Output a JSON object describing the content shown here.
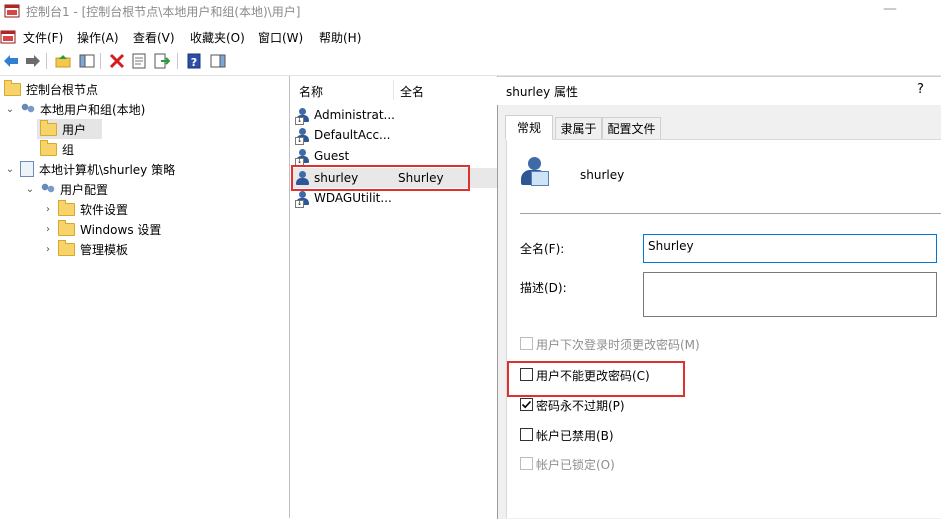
{
  "window": {
    "title": "控制台1 - [控制台根节点\\本地用户和组(本地)\\用户]",
    "minimize_glyph": "—"
  },
  "menu": {
    "items": [
      "文件(F)",
      "操作(A)",
      "查看(V)",
      "收藏夹(O)",
      "窗口(W)",
      "帮助(H)"
    ]
  },
  "toolbar": {
    "icons": [
      "back-arrow-icon",
      "forward-arrow-icon",
      "up-folder-icon",
      "show-hide-tree-icon",
      "delete-icon",
      "properties-icon",
      "export-list-icon",
      "help-icon",
      "show-hide-action-pane-icon"
    ]
  },
  "tree": {
    "root": "控制台根节点",
    "local_users_groups": "本地用户和组(本地)",
    "users": "用户",
    "groups": "组",
    "local_policy": "本地计算机\\shurley 策略",
    "user_config": "用户配置",
    "software_settings": "软件设置",
    "windows_settings": "Windows 设置",
    "admin_templates": "管理模板"
  },
  "list": {
    "columns": [
      "名称",
      "全名"
    ],
    "rows": [
      {
        "name": "Administrat...",
        "fullname": ""
      },
      {
        "name": "DefaultAcc...",
        "fullname": ""
      },
      {
        "name": "Guest",
        "fullname": ""
      },
      {
        "name": "shurley",
        "fullname": "Shurley"
      },
      {
        "name": "WDAGUtilit...",
        "fullname": ""
      }
    ],
    "selected_index": 3
  },
  "dialog": {
    "title": "shurley 属性",
    "help": "?",
    "tabs": [
      "常规",
      "隶属于",
      "配置文件"
    ],
    "active_tab": 0,
    "username": "shurley",
    "fullname_label": "全名(F):",
    "fullname_value": "Shurley",
    "description_label": "描述(D):",
    "description_value": "",
    "checkboxes": [
      {
        "label": "用户下次登录时须更改密码(M)",
        "checked": false,
        "enabled": false
      },
      {
        "label": "用户不能更改密码(C)",
        "checked": false,
        "enabled": true
      },
      {
        "label": "密码永不过期(P)",
        "checked": true,
        "enabled": true
      },
      {
        "label": "帐户已禁用(B)",
        "checked": false,
        "enabled": true
      },
      {
        "label": "帐户已锁定(O)",
        "checked": false,
        "enabled": false
      }
    ]
  },
  "colors": {
    "highlight_red": "#e03131",
    "focus_blue": "#0078d7",
    "selection_gray": "#e5e5e5"
  }
}
